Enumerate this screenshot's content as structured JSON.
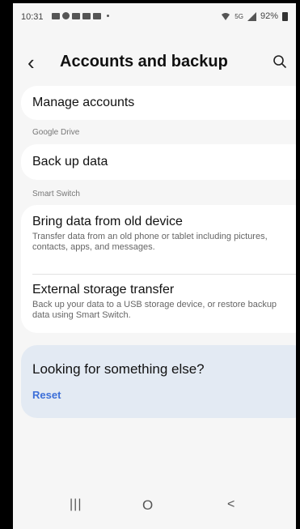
{
  "status_bar": {
    "time": "10:31",
    "network": "5G",
    "battery": "92%"
  },
  "header": {
    "title": "Accounts and backup"
  },
  "main": {
    "manage_accounts": "Manage accounts",
    "google_drive_label": "Google Drive",
    "back_up_data": "Back up data",
    "smart_switch_label": "Smart Switch",
    "bring_data": {
      "title": "Bring data from old device",
      "subtitle": "Transfer data from an old phone or tablet including pictures, contacts, apps, and messages."
    },
    "external_storage": {
      "title": "External storage transfer",
      "subtitle": "Back up your data to a USB storage device, or restore backup data using Smart Switch."
    }
  },
  "promo": {
    "heading": "Looking for something else?",
    "reset": "Reset"
  },
  "nav": {
    "recents": "|||",
    "home": "O",
    "back": "<"
  },
  "colors": {
    "accent": "#3d6fd8",
    "background": "#f6f6f6",
    "promo_bg": "#e3eaf3"
  },
  "icons": [
    "back-arrow-icon",
    "search-icon",
    "wifi-icon",
    "signal-icon",
    "battery-icon"
  ]
}
